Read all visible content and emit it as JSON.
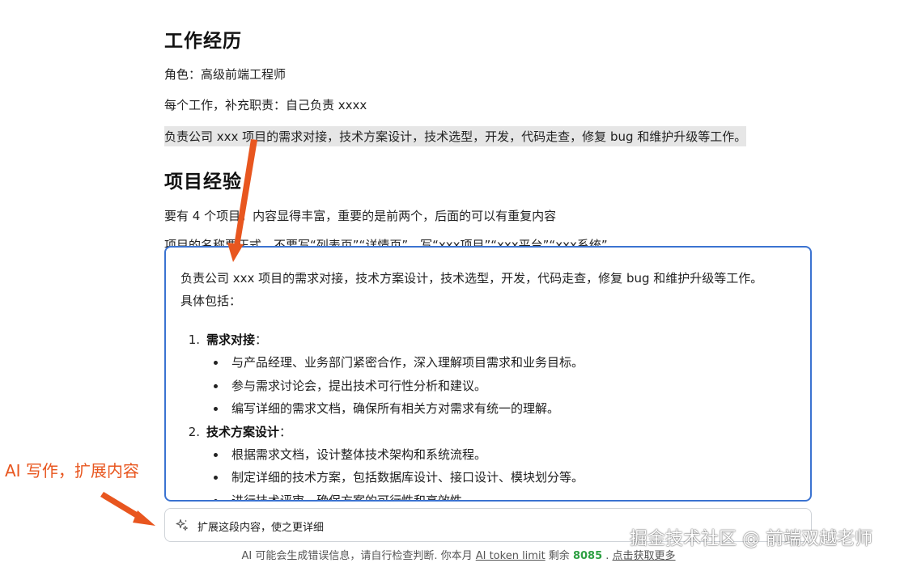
{
  "doc": {
    "work_heading": "工作经历",
    "role_line": "角色：高级前端工程师",
    "duty_hint": "每个工作，补充职责：自己负责 xxxx",
    "selected_line": "负责公司 xxx 项目的需求对接，技术方案设计，技术选型，开发，代码走查，修复 bug 和维护升级等工作。",
    "project_heading": "项目经验",
    "project_line1": "要有 4 个项目，内容显得丰富，重要的是前两个，后面的可以有重复内容",
    "project_line2": "项目的名称要正式，不要写“列表页”“详情页”，写“xxx项目”“xxx平台”“xxx系统”"
  },
  "ai_result": {
    "intro_line1": "负责公司 xxx 项目的需求对接，技术方案设计，技术选型，开发，代码走查，修复 bug 和维护升级等工作。",
    "intro_line2": "具体包括：",
    "sections": [
      {
        "num": "1.",
        "title": "需求对接",
        "colon": "：",
        "bullets": [
          "与产品经理、业务部门紧密合作，深入理解项目需求和业务目标。",
          "参与需求讨论会，提出技术可行性分析和建议。",
          "编写详细的需求文档，确保所有相关方对需求有统一的理解。"
        ]
      },
      {
        "num": "2.",
        "title": "技术方案设计",
        "colon": "：",
        "bullets": [
          "根据需求文档，设计整体技术架构和系统流程。",
          "制定详细的技术方案，包括数据库设计、接口设计、模块划分等。",
          "进行技术评审，确保方案的可行性和高效性。"
        ]
      }
    ]
  },
  "prompt": {
    "icon": "sparkle-icon",
    "text": "扩展这段内容，使之更详细"
  },
  "disclaimer": {
    "part1": "AI 可能会生成错误信息，请自行检查判断. 你本月 ",
    "token_link": "AI token limit",
    "part2": " 剩余 ",
    "tokens_left": "8085",
    "part3": " . ",
    "get_more_link": "点击获取更多"
  },
  "annotation": {
    "label": "AI 写作，扩展内容",
    "color": "#e8561f"
  },
  "watermark": "掘金技术社区 @ 前端双越老师",
  "colors": {
    "panel_border": "#3b73d1",
    "selection": "#e6e6e6",
    "tokens": "#2ea043"
  }
}
